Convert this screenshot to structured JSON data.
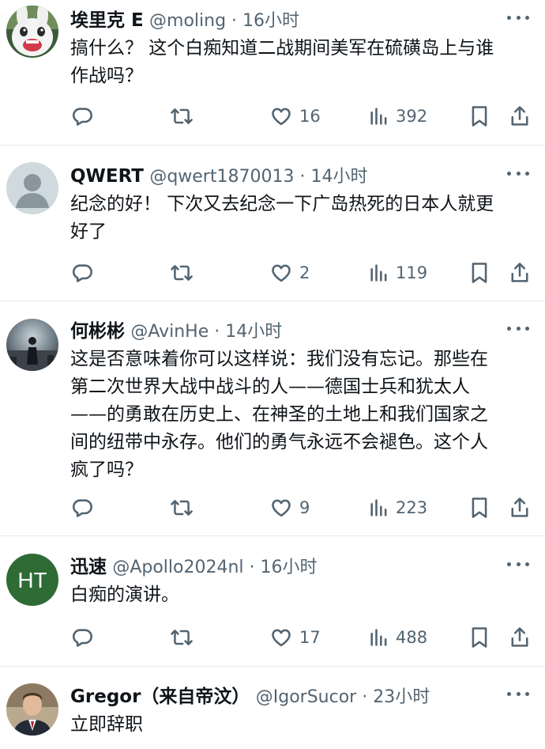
{
  "tweets": [
    {
      "name": "埃里克 E",
      "handle": "@moling",
      "time": "16小时",
      "text": "搞什么？ 这个白痴知道二战期间美军在硫磺岛上与谁\n作战吗？",
      "likes": "16",
      "views": "392",
      "avatar_icon": "white-rabbit-cartoon-avatar"
    },
    {
      "name": "QWERT",
      "handle": "@qwert1870013",
      "time": "14小时",
      "text": "纪念的好！ 下次又去纪念一下广岛热死的日本人就更\n好了",
      "likes": "2",
      "views": "119",
      "avatar_icon": "default-person-avatar"
    },
    {
      "name": "何彬彬",
      "handle": "@AvinHe",
      "time": "14小时",
      "text": "这是否意味着你可以这样说：我们没有忘记。那些在\n第二次世界大战中战斗的人——德国士兵和犹太人\n——的勇敢在历史上、在神圣的土地上和我们国家之\n间的纽带中永存。他们的勇气永远不会褪色。这个人\n疯了吗？",
      "likes": "9",
      "views": "223",
      "avatar_icon": "dark-figure-photo-avatar"
    },
    {
      "name": "迅速",
      "handle": "@Apollo2024nl",
      "time": "16小时",
      "text": "白痴的演讲。",
      "likes": "17",
      "views": "488",
      "avatar_icon": "initials-avatar",
      "avatar_initials": "HT",
      "avatar_color": "#2e6b35"
    },
    {
      "name": "Gregor（来自帝汶）",
      "handle": "@IgorSucor",
      "time": "23小时",
      "text": "立即辞职",
      "avatar_icon": "man-in-suit-photo-avatar"
    }
  ],
  "separator": " · ",
  "colors": {
    "text": "#0f1419",
    "muted": "#536471",
    "divider": "#e6e9ec"
  }
}
